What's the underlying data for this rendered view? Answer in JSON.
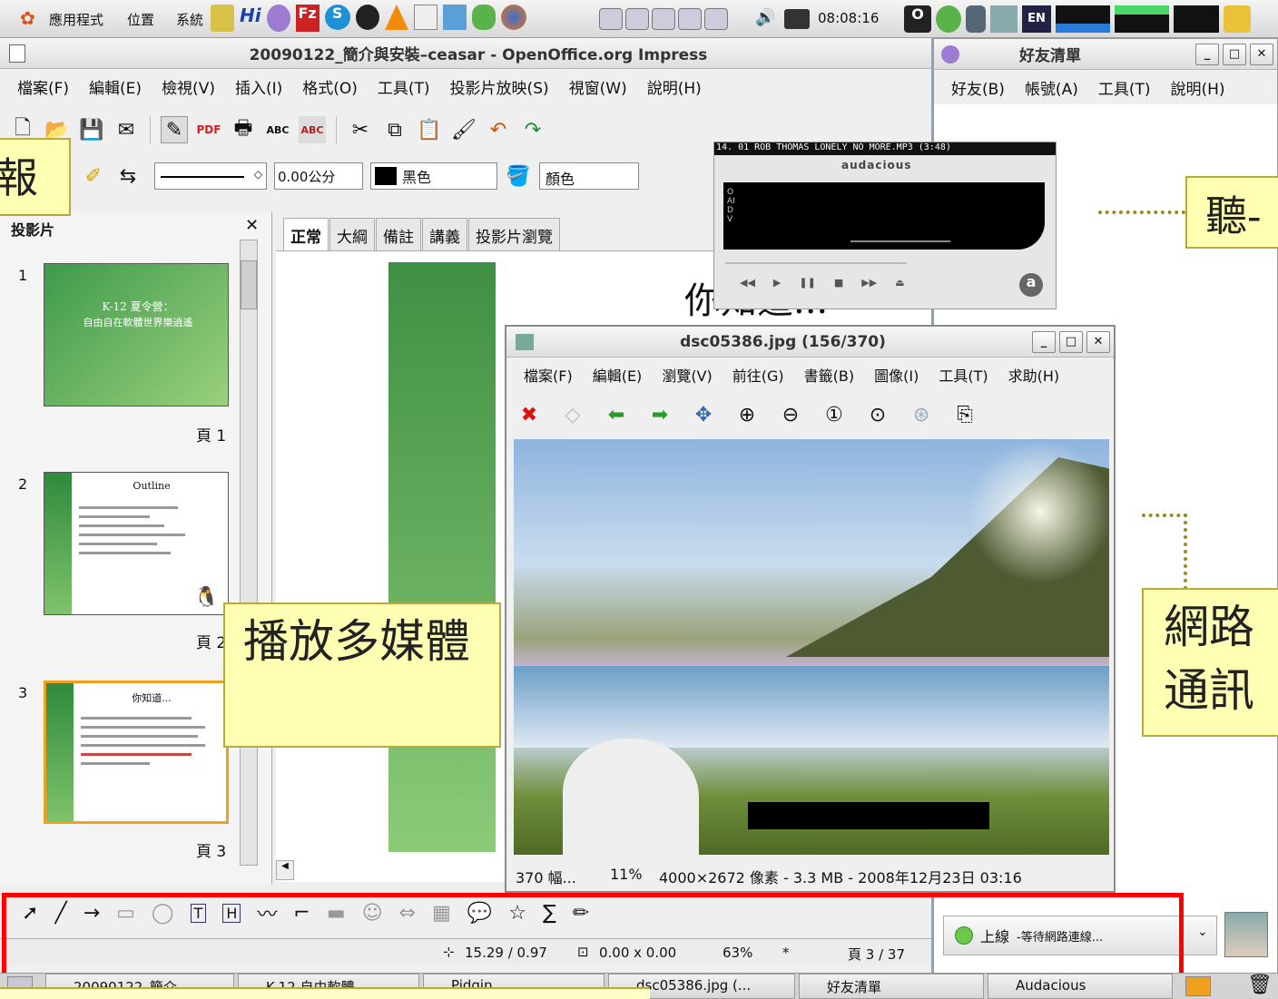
{
  "top_panel": {
    "menus": [
      "應用程式",
      "位置",
      "系統"
    ],
    "clock": "08:08:16"
  },
  "impress": {
    "title": "20090122_簡介與安裝–ceasar - OpenOffice.org Impress",
    "menu": [
      "檔案(F)",
      "編輯(E)",
      "檢視(V)",
      "插入(I)",
      "格式(O)",
      "工具(T)",
      "投影片放映(S)",
      "視窗(W)",
      "說明(H)"
    ],
    "line_width": "0.00公分",
    "color_name": "黑色",
    "fill_label": "顏色",
    "slides_pane_title": "投影片",
    "tabs": [
      "正常",
      "大綱",
      "備註",
      "講義",
      "投影片瀏覽"
    ],
    "slides": [
      {
        "num": "1",
        "title": "K-12 夏令營：",
        "subtitle": "自由自在軟體世界樂逍遙",
        "label": "頁 1"
      },
      {
        "num": "2",
        "title": "Outline",
        "label": "頁 2"
      },
      {
        "num": "3",
        "title": "你知道...",
        "label": "頁 3"
      }
    ],
    "slide_heading": "你知道...",
    "status": {
      "position": "15.29 / 0.97",
      "size": "0.00 x 0.00",
      "zoom": "63%",
      "modified": "*",
      "page": "頁 3 / 37"
    }
  },
  "audacious": {
    "song": "14. 01 ROB THOMAS LONELY NO MORE.MP3 (3:48)",
    "brand": "audacious",
    "vert": "OAIDV"
  },
  "image_viewer": {
    "title": "dsc05386.jpg (156/370)",
    "menu": [
      "檔案(F)",
      "編輯(E)",
      "瀏覽(V)",
      "前往(G)",
      "書籤(B)",
      "圖像(I)",
      "工具(T)",
      "求助(H)"
    ],
    "status_count": "370 幅...",
    "status_zoom": "11%",
    "status_info": "4000×2672 像素 - 3.3 MB - 2008年12月23日 03:16"
  },
  "buddy_list": {
    "title": "好友清單",
    "menu": [
      "好友(B)",
      "帳號(A)",
      "工具(T)",
      "說明(H)"
    ],
    "status": "上線",
    "status_detail": "-等待網路連線..."
  },
  "callouts": {
    "left": "報",
    "multimedia": "播放多媒體",
    "listen": "聽-",
    "network": "網路通訊"
  },
  "taskbar": [
    "20090122_簡介...",
    "K-12 自由軟體...",
    "Pidgin...",
    "dsc05386.jpg (...",
    "好友清單",
    "Audacious"
  ],
  "colors": {
    "highlight_box": "#ff0000",
    "callout_bg": "#ffffb3",
    "slide_green": "#3d9a4a"
  }
}
